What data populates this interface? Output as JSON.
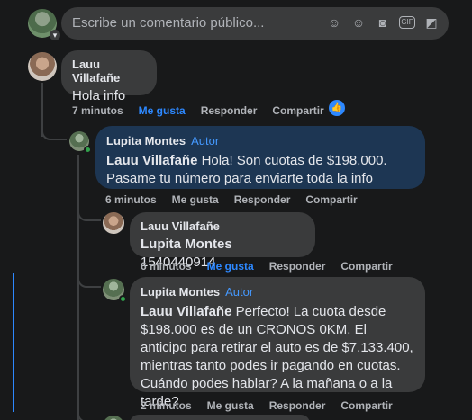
{
  "composer": {
    "placeholder": "Escribe un comentario público..."
  },
  "comments": [
    {
      "author": "Lauu Villafañe",
      "text": "Hola info",
      "time": "7 minutos",
      "like_label": "Me gusta",
      "reply_label": "Responder",
      "share_label": "Compartir",
      "liked": true,
      "reaction_icon": "thumbs-up-icon"
    },
    {
      "author": "Lupita Montes",
      "badge": "Autor",
      "mention": "Lauu Villafañe",
      "text": "Hola! Son cuotas de $198.000. Pasame tu número para enviarte toda la info",
      "time": "6 minutos",
      "like_label": "Me gusta",
      "reply_label": "Responder",
      "share_label": "Compartir"
    },
    {
      "author": "Lauu Villafañe",
      "mention": "Lupita Montes",
      "text": "1540440914",
      "time": "6 minutos",
      "like_label": "Me gusta",
      "reply_label": "Responder",
      "share_label": "Compartir",
      "liked": true
    },
    {
      "author": "Lupita Montes",
      "badge": "Autor",
      "mention": "Lauu Villafañe",
      "text": "Perfecto! La cuota desde $198.000 es de un CRONOS 0KM. El anticipo para retirar el auto es de $7.133.400, mientras tanto podes ir pagando en cuotas. Cuándo podes hablar? A la mañana o a la tarde?",
      "time": "2 minutos",
      "like_label": "Me gusta",
      "reply_label": "Responder",
      "share_label": "Compartir"
    }
  ],
  "colors": {
    "accent": "#2d88ff",
    "highlight_bubble": "#1d3653",
    "bubble": "#3a3b3c",
    "online": "#31a24c"
  }
}
